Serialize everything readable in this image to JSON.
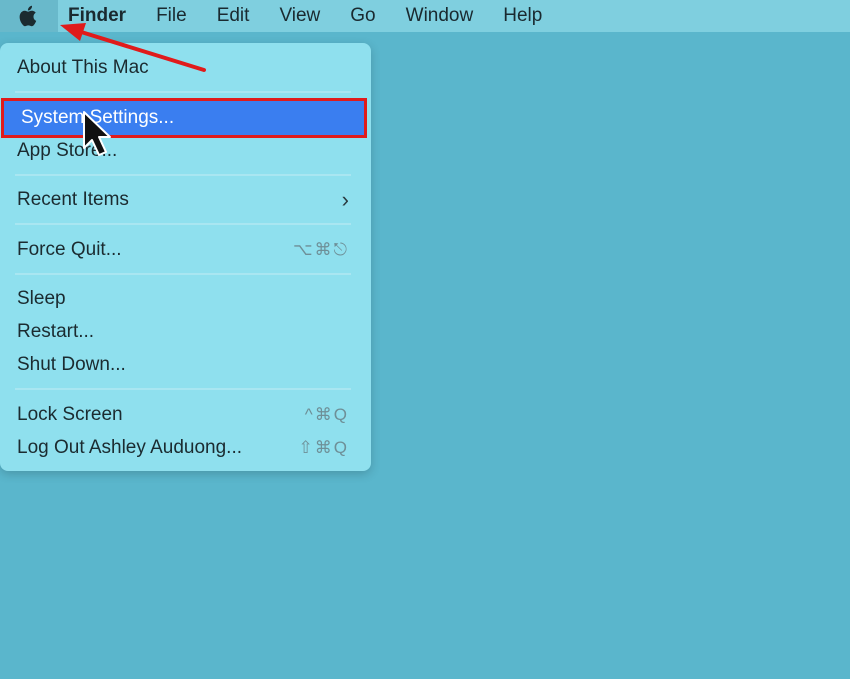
{
  "menubar": {
    "apple_icon": "apple-logo-icon",
    "items": [
      "Finder",
      "File",
      "Edit",
      "View",
      "Go",
      "Window",
      "Help"
    ]
  },
  "apple_menu": {
    "about": "About This Mac",
    "system_settings": "System Settings...",
    "app_store": "App Store...",
    "recent_items": "Recent Items",
    "force_quit": "Force Quit...",
    "force_quit_shortcut": "⌥⌘⎋",
    "sleep": "Sleep",
    "restart": "Restart...",
    "shut_down": "Shut Down...",
    "lock_screen": "Lock Screen",
    "lock_screen_shortcut": "^⌘Q",
    "log_out": "Log Out Ashley Auduong...",
    "log_out_shortcut": "⇧⌘Q"
  },
  "colors": {
    "desktop": "#5ab6cc",
    "menu_bg": "#8fe0ee",
    "highlight": "#3a7ef0",
    "annotation_red": "#e01b1b"
  }
}
